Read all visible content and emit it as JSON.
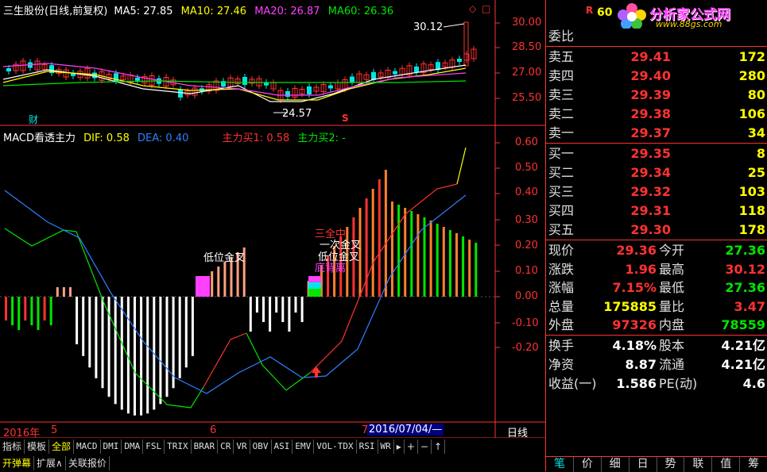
{
  "header": {
    "stock_title": "三生股份(日线,前复权)",
    "ma5": "MA5: 27.85",
    "ma10": "MA10: 27.46",
    "ma20": "MA20: 26.87",
    "ma60": "MA60: 26.36",
    "high_marker": "30.12",
    "low_marker": "24.57",
    "cai_marker": "财",
    "s_marker": "S"
  },
  "price_axis": [
    "30.00",
    "28.50",
    "27.00",
    "25.50"
  ],
  "indicator": {
    "title": "MACD看透主力",
    "dif": "DIF: 0.58",
    "dea": "DEA: 0.40",
    "zhuli1": "主力买1: 0.58",
    "zhuli2": "主力买2: -",
    "labels": {
      "low_golden_1": "低位金叉",
      "low_golden_2": "低位金叉",
      "sanquan": "三全中",
      "yici": "一次金叉",
      "dibei": "底背离"
    },
    "axis": [
      "0.60",
      "0.50",
      "0.40",
      "0.30",
      "0.20",
      "0.10",
      "0.00",
      "-0.10",
      "-0.20"
    ]
  },
  "date_axis": {
    "year": "2016年",
    "m5": "5",
    "m6": "6",
    "m7": "7",
    "cursor_date": "2016/07/04/—",
    "period": "日线"
  },
  "tabs_row1": [
    {
      "name": "tab-indicator",
      "label": "指标",
      "mono": false,
      "active": false
    },
    {
      "name": "tab-template",
      "label": "模板",
      "mono": false,
      "active": false
    },
    {
      "name": "tab-all",
      "label": "全部",
      "mono": false,
      "active": true
    },
    {
      "name": "tab-macd",
      "label": "MACD",
      "mono": true,
      "active": false
    },
    {
      "name": "tab-dmi",
      "label": "DMI",
      "mono": true,
      "active": false
    },
    {
      "name": "tab-dma",
      "label": "DMA",
      "mono": true,
      "active": false
    },
    {
      "name": "tab-fsl",
      "label": "FSL",
      "mono": true,
      "active": false
    },
    {
      "name": "tab-trix",
      "label": "TRIX",
      "mono": true,
      "active": false
    },
    {
      "name": "tab-brar",
      "label": "BRAR",
      "mono": true,
      "active": false
    },
    {
      "name": "tab-cr",
      "label": "CR",
      "mono": true,
      "active": false
    },
    {
      "name": "tab-vr",
      "label": "VR",
      "mono": true,
      "active": false
    },
    {
      "name": "tab-obv",
      "label": "OBV",
      "mono": true,
      "active": false
    },
    {
      "name": "tab-asi",
      "label": "ASI",
      "mono": true,
      "active": false
    },
    {
      "name": "tab-emv",
      "label": "EMV",
      "mono": true,
      "active": false
    },
    {
      "name": "tab-voltdx",
      "label": "VOL-TDX",
      "mono": true,
      "active": false
    },
    {
      "name": "tab-rsi",
      "label": "RSI",
      "mono": true,
      "active": false
    },
    {
      "name": "tab-wr",
      "label": "WR",
      "mono": true,
      "active": false
    },
    {
      "name": "tab-more",
      "label": "▸",
      "mono": false,
      "active": false
    },
    {
      "name": "tab-plus",
      "label": "+",
      "mono": false,
      "active": false
    },
    {
      "name": "tab-minus",
      "label": "−",
      "mono": false,
      "active": false
    },
    {
      "name": "tab-up",
      "label": "↑",
      "mono": false,
      "active": false
    }
  ],
  "tabs_row2": [
    {
      "name": "tab-popup",
      "label": "开弹幕",
      "active": true
    },
    {
      "name": "tab-expand",
      "label": "扩展∧",
      "active": false
    },
    {
      "name": "tab-related",
      "label": "关联报价",
      "active": false
    }
  ],
  "quote": {
    "logo_text": "分析家公式网",
    "logo_url": "www.88gs.com",
    "top_mark": "R",
    "top_num": "60",
    "weibi_label": "委比",
    "asks": [
      {
        "label": "卖五",
        "price": "29.41",
        "vol": "172"
      },
      {
        "label": "卖四",
        "price": "29.40",
        "vol": "280"
      },
      {
        "label": "卖三",
        "price": "29.39",
        "vol": "80"
      },
      {
        "label": "卖二",
        "price": "29.38",
        "vol": "106"
      },
      {
        "label": "卖一",
        "price": "29.37",
        "vol": "34"
      }
    ],
    "bids": [
      {
        "label": "买一",
        "price": "29.35",
        "vol": "8"
      },
      {
        "label": "买二",
        "price": "29.34",
        "vol": "25"
      },
      {
        "label": "买三",
        "price": "29.32",
        "vol": "103"
      },
      {
        "label": "买四",
        "price": "29.31",
        "vol": "118"
      },
      {
        "label": "买五",
        "price": "29.30",
        "vol": "178"
      }
    ],
    "stats1": [
      {
        "l1": "现价",
        "v1": "29.36",
        "c1": "#ff3232",
        "l2": "今开",
        "v2": "27.36",
        "c2": "#00e600"
      },
      {
        "l1": "涨跌",
        "v1": "1.96",
        "c1": "#ff3232",
        "l2": "最高",
        "v2": "30.12",
        "c2": "#ff3232"
      },
      {
        "l1": "涨幅",
        "v1": "7.15%",
        "c1": "#ff3232",
        "l2": "最低",
        "v2": "27.36",
        "c2": "#00e600"
      },
      {
        "l1": "总量",
        "v1": "175885",
        "c1": "#ffff00",
        "l2": "量比",
        "v2": "3.47",
        "c2": "#ff3232"
      },
      {
        "l1": "外盘",
        "v1": "97326",
        "c1": "#ff3232",
        "l2": "内盘",
        "v2": "78559",
        "c2": "#00e600"
      }
    ],
    "stats2": [
      {
        "l1": "换手",
        "v1": "4.18%",
        "l2": "股本",
        "v2": "4.21亿"
      },
      {
        "l1": "净资",
        "v1": "8.87",
        "l2": "流通",
        "v2": "4.21亿"
      },
      {
        "l1": "收益(一)",
        "v1": "1.586",
        "l2": "PE(动)",
        "v2": "4.6"
      }
    ],
    "bottom_tabs": [
      "笔",
      "价",
      "细",
      "日",
      "势",
      "联",
      "值",
      "筹"
    ]
  }
}
